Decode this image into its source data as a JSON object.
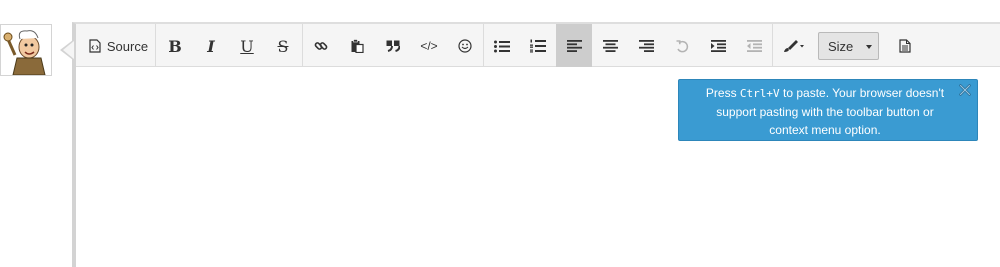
{
  "toolbar": {
    "source_label": "Source",
    "bold_glyph": "B",
    "italic_glyph": "I",
    "underline_glyph": "U",
    "strike_glyph": "S",
    "code_glyph": "</>",
    "size_label": "Size",
    "active_button": "align-left"
  },
  "notification": {
    "text_before": "Press ",
    "shortcut": "Ctrl+V",
    "text_after": " to paste. Your browser doesn't support pasting with the toolbar button or context menu option.",
    "background": "#3a9bd2"
  },
  "colors": {
    "toolbar_bg": "#f5f5f5",
    "active_bg": "#cdcdcd",
    "notice_bg": "#3a9bd2"
  }
}
